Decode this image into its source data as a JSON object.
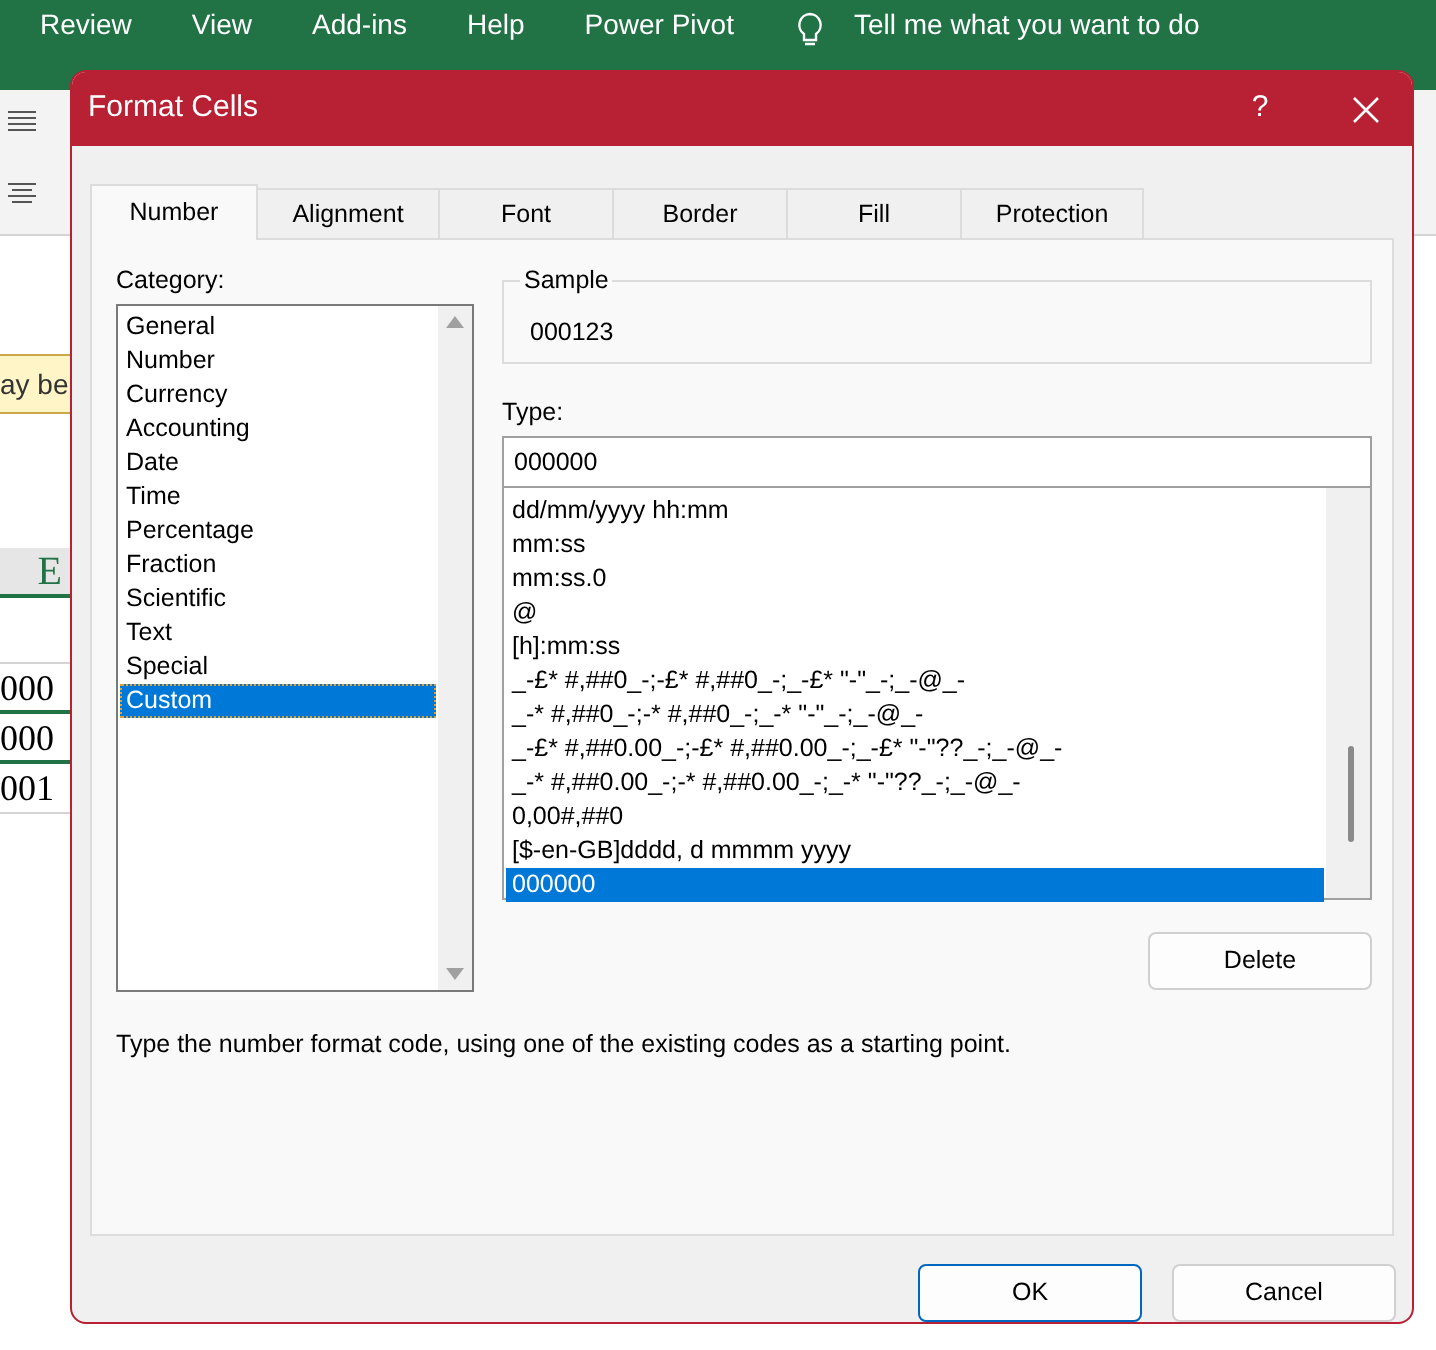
{
  "app": {
    "ribbon_tabs": [
      "Review",
      "View",
      "Add-ins",
      "Help",
      "Power Pivot"
    ],
    "tell_me": "Tell me what you want to do",
    "message_fragment": "ay be",
    "column_header": "E",
    "cells": [
      "000",
      "000",
      "001"
    ]
  },
  "dialog": {
    "title": "Format Cells",
    "help": "?",
    "tabs": [
      {
        "label": "Number",
        "selected": true
      },
      {
        "label": "Alignment",
        "selected": false
      },
      {
        "label": "Font",
        "selected": false
      },
      {
        "label": "Border",
        "selected": false
      },
      {
        "label": "Fill",
        "selected": false
      },
      {
        "label": "Protection",
        "selected": false
      }
    ],
    "category_label": "Category:",
    "categories": [
      {
        "label": "General",
        "selected": false
      },
      {
        "label": "Number",
        "selected": false
      },
      {
        "label": "Currency",
        "selected": false
      },
      {
        "label": "Accounting",
        "selected": false
      },
      {
        "label": "Date",
        "selected": false
      },
      {
        "label": "Time",
        "selected": false
      },
      {
        "label": "Percentage",
        "selected": false
      },
      {
        "label": "Fraction",
        "selected": false
      },
      {
        "label": "Scientific",
        "selected": false
      },
      {
        "label": "Text",
        "selected": false
      },
      {
        "label": "Special",
        "selected": false
      },
      {
        "label": "Custom",
        "selected": true
      }
    ],
    "sample_label": "Sample",
    "sample_value": "000123",
    "type_label": "Type:",
    "type_value": "000000",
    "formats": [
      {
        "label": "dd/mm/yyyy hh:mm",
        "selected": false
      },
      {
        "label": "mm:ss",
        "selected": false
      },
      {
        "label": "mm:ss.0",
        "selected": false
      },
      {
        "label": "@",
        "selected": false
      },
      {
        "label": "[h]:mm:ss",
        "selected": false
      },
      {
        "label": "_-£* #,##0_-;-£* #,##0_-;_-£* \"-\"_-;_-@_-",
        "selected": false
      },
      {
        "label": "_-* #,##0_-;-* #,##0_-;_-* \"-\"_-;_-@_-",
        "selected": false
      },
      {
        "label": "_-£* #,##0.00_-;-£* #,##0.00_-;_-£* \"-\"??_-;_-@_-",
        "selected": false
      },
      {
        "label": "_-* #,##0.00_-;-* #,##0.00_-;_-* \"-\"??_-;_-@_-",
        "selected": false
      },
      {
        "label": "0,00#,##0",
        "selected": false
      },
      {
        "label": "[$-en-GB]dddd, d mmmm yyyy",
        "selected": false
      },
      {
        "label": "000000",
        "selected": true
      }
    ],
    "delete_button": "Delete",
    "description": "Type the number format code, using one of the existing codes as a starting point.",
    "buttons": [
      {
        "label": "OK",
        "kind": "default"
      },
      {
        "label": "Cancel",
        "kind": "normal"
      }
    ]
  }
}
